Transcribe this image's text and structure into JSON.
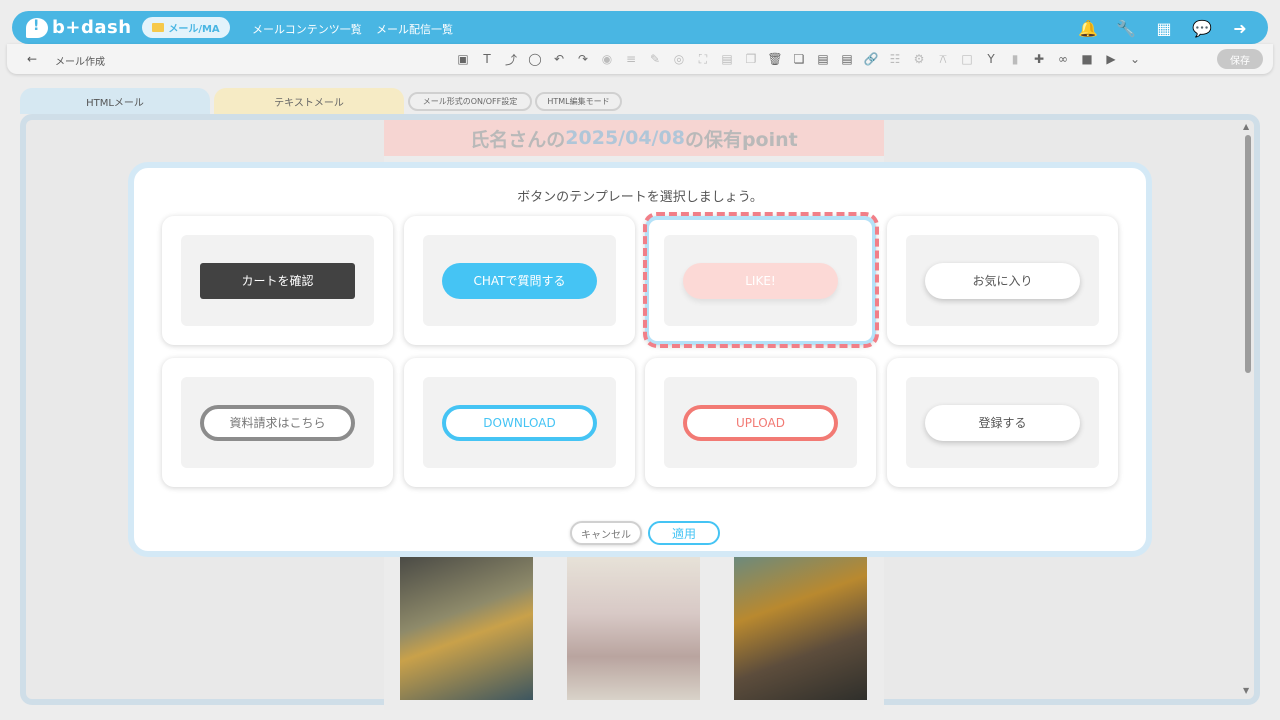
{
  "app": {
    "logo": "b+dash"
  },
  "nav": {
    "active": "メール/MA",
    "links": [
      "メールコンテンツ一覧",
      "メール配信一覧"
    ]
  },
  "toolbar": {
    "back": "←",
    "breadcrumb": "メール作成",
    "save": "保存"
  },
  "tabs": {
    "html": "HTMLメール",
    "text": "テキストメール",
    "toggle": "メール形式のON/OFF設定",
    "html_edit": "HTML編集モード"
  },
  "preview": {
    "title_part1": "氏名さんの",
    "title_date": "2025/04/08",
    "title_part2": "の保有point"
  },
  "modal": {
    "title": "ボタンのテンプレートを選択しましょう。",
    "templates": [
      {
        "label": "カートを確認"
      },
      {
        "label": "CHATで質問する"
      },
      {
        "label": "LIKE!"
      },
      {
        "label": "お気に入り"
      },
      {
        "label": "資料請求はこちら"
      },
      {
        "label": "DOWNLOAD"
      },
      {
        "label": "UPLOAD"
      },
      {
        "label": "登録する"
      }
    ],
    "selected_index": 2,
    "cancel": "キャンセル",
    "apply": "適用"
  },
  "colors": {
    "brand": "#49b6e3",
    "accent_blue": "#45c4f4",
    "accent_red": "#f27a74",
    "selection_ring": "#f17f88"
  }
}
